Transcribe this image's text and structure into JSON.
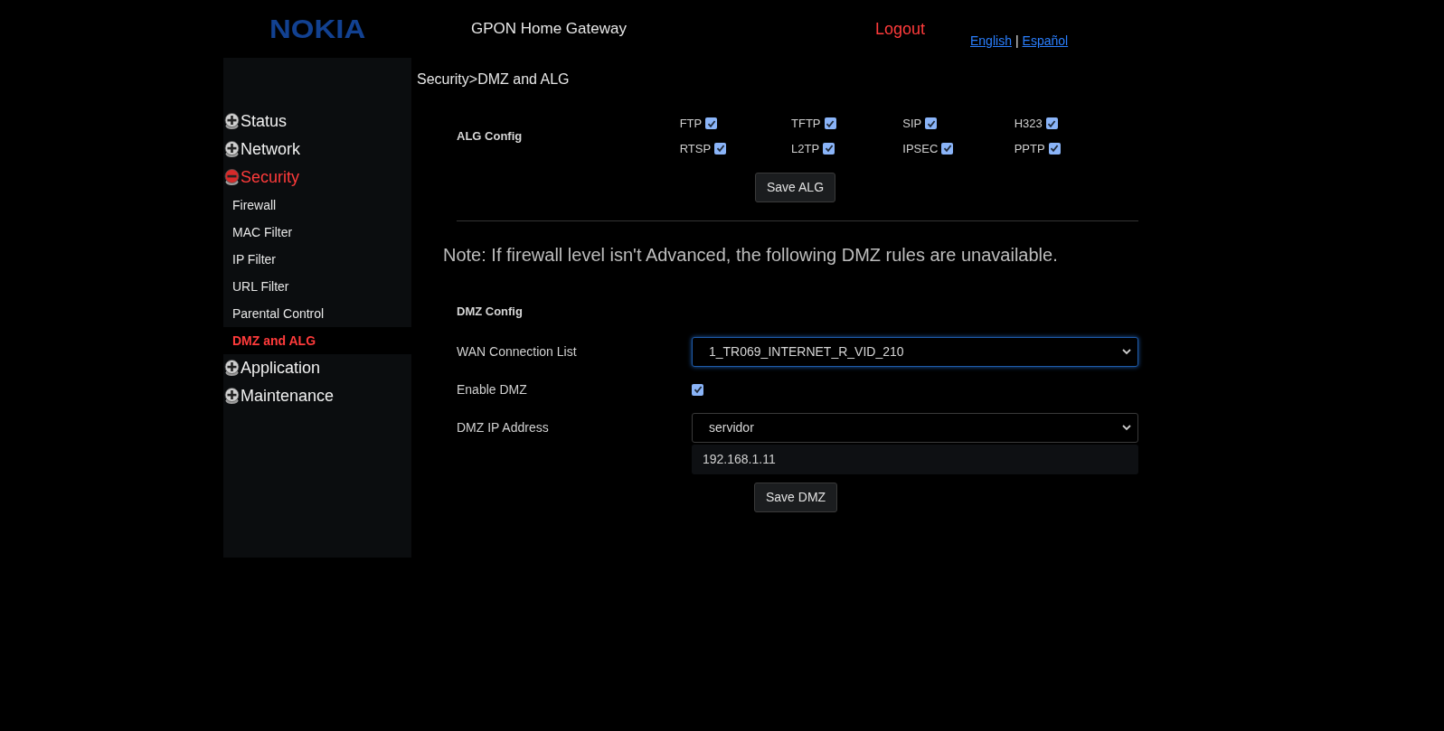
{
  "header": {
    "logo": "NOKIA",
    "title": "GPON Home Gateway",
    "logout": "Logout",
    "languages": [
      "English",
      "Español"
    ],
    "separator": "|"
  },
  "sidebar": {
    "items": [
      {
        "label": "Status",
        "expanded": false
      },
      {
        "label": "Network",
        "expanded": false
      },
      {
        "label": "Security",
        "expanded": true,
        "children": [
          {
            "label": "Firewall",
            "selected": false
          },
          {
            "label": "MAC Filter",
            "selected": false
          },
          {
            "label": "IP Filter",
            "selected": false
          },
          {
            "label": "URL Filter",
            "selected": false
          },
          {
            "label": "Parental Control",
            "selected": false
          },
          {
            "label": "DMZ and ALG",
            "selected": true
          }
        ]
      },
      {
        "label": "Application",
        "expanded": false
      },
      {
        "label": "Maintenance",
        "expanded": false
      }
    ]
  },
  "breadcrumb": "Security>DMZ and ALG",
  "alg": {
    "title": "ALG Config",
    "protocols": [
      {
        "label": "FTP",
        "checked": true
      },
      {
        "label": "TFTP",
        "checked": true
      },
      {
        "label": "SIP",
        "checked": true
      },
      {
        "label": "H323",
        "checked": true
      },
      {
        "label": "RTSP",
        "checked": true
      },
      {
        "label": "L2TP",
        "checked": true
      },
      {
        "label": "IPSEC",
        "checked": true
      },
      {
        "label": "PPTP",
        "checked": true
      }
    ],
    "button": "Save ALG"
  },
  "note": "Note: If firewall level isn't Advanced, the following DMZ rules are unavailable.",
  "dmz": {
    "title": "DMZ Config",
    "fields": [
      {
        "kind": "select",
        "label": "WAN Connection List",
        "value": "1_TR069_INTERNET_R_VID_210",
        "focused": true
      },
      {
        "kind": "checkbox",
        "label": "Enable DMZ",
        "checked": true
      },
      {
        "kind": "select",
        "label": "DMZ IP Address",
        "value": "servidor",
        "focused": false,
        "suggestion": "192.168.1.11"
      }
    ],
    "button": "Save DMZ"
  }
}
